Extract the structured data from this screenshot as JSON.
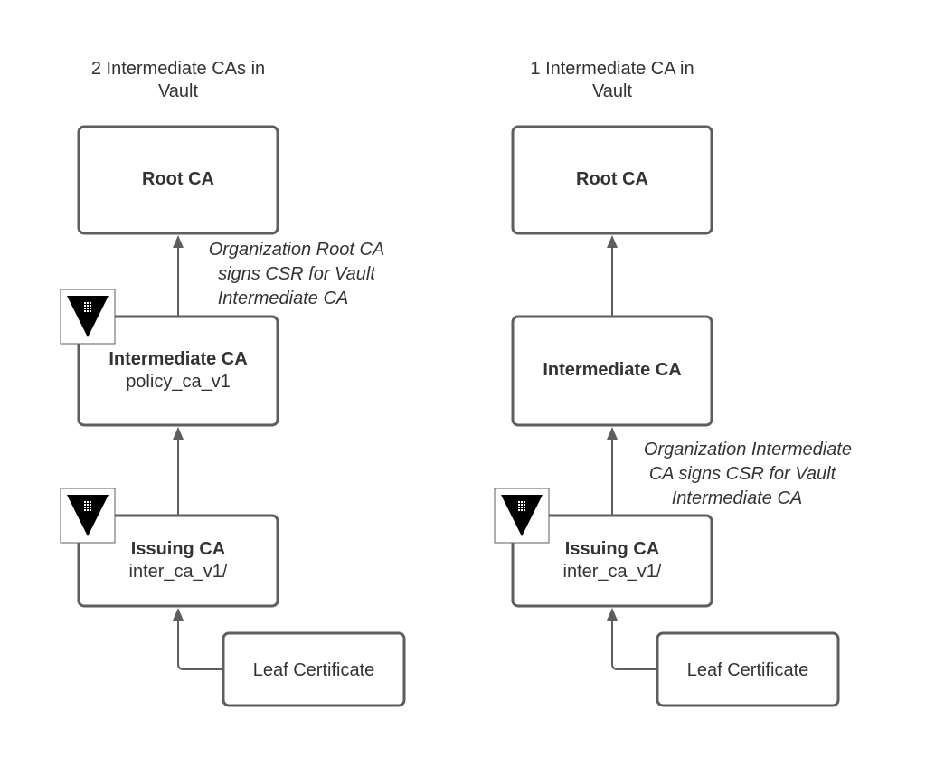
{
  "left": {
    "title": [
      "2 Intermediate CAs in",
      "Vault"
    ],
    "root": "Root CA",
    "intermediate": {
      "title": "Intermediate CA",
      "subtitle": "policy_ca_v1"
    },
    "issuing": {
      "title": "Issuing CA",
      "subtitle": "inter_ca_v1/"
    },
    "leaf": "Leaf Certificate",
    "annotation": [
      "Organization Root CA",
      "signs CSR for Vault",
      "Intermediate CA"
    ]
  },
  "right": {
    "title": [
      "1 Intermediate CA in",
      "Vault"
    ],
    "root": "Root CA",
    "intermediate": {
      "title": "Intermediate CA"
    },
    "issuing": {
      "title": "Issuing CA",
      "subtitle": "inter_ca_v1/"
    },
    "leaf": "Leaf Certificate",
    "annotation": [
      "Organization Intermediate",
      "CA signs CSR for Vault",
      "Intermediate CA"
    ]
  },
  "icons": [
    "vault-logo-icon"
  ]
}
